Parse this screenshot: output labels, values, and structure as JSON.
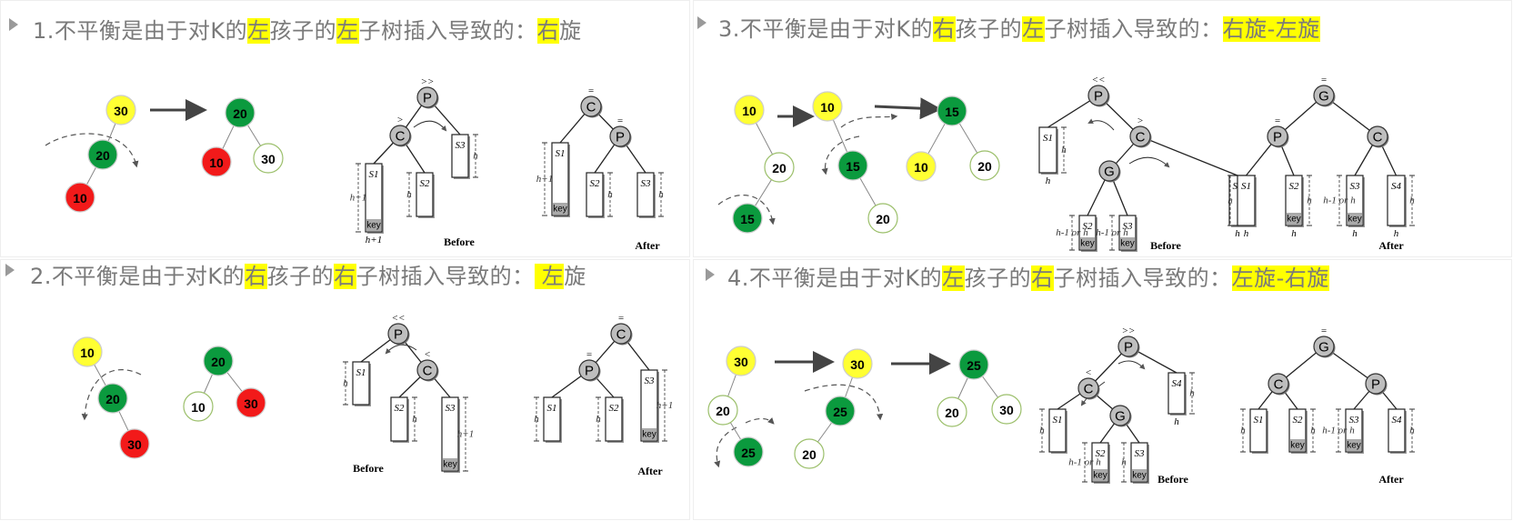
{
  "colors": {
    "yellow": "#ffff33",
    "green": "#0b9a3e",
    "red": "#f21a1a",
    "white": "#ffffff",
    "node_gray": "#bebebe",
    "highlight": "#ffff00",
    "title_text": "#7a7a7a"
  },
  "panels": [
    {
      "title": [
        {
          "t": "1.不平衡是由于对K的"
        },
        {
          "t": "左",
          "hl": true
        },
        {
          "t": "孩子的"
        },
        {
          "t": "左",
          "hl": true
        },
        {
          "t": "子树插入导致的："
        },
        {
          "t": "右",
          "hl": true
        },
        {
          "t": "旋"
        }
      ],
      "number_nodes": [
        {
          "label": "30",
          "color": "yellow"
        },
        {
          "label": "20",
          "color": "green"
        },
        {
          "label": "10",
          "color": "red"
        },
        {
          "label": "20",
          "color": "green"
        },
        {
          "label": "10",
          "color": "red"
        },
        {
          "label": "30",
          "color": "white"
        }
      ],
      "before": {
        "caption": "Before",
        "nodes": [
          {
            "label": "P",
            "mark": ">>"
          },
          {
            "label": "C",
            "mark": ">"
          }
        ],
        "subtrees": [
          {
            "label": "S1",
            "key": "key",
            "height": "h+1",
            "below": "h+1"
          },
          {
            "label": "S2",
            "height": "h"
          },
          {
            "label": "S3",
            "height": "h"
          }
        ]
      },
      "after": {
        "caption": "After",
        "nodes": [
          {
            "label": "C",
            "mark": "="
          },
          {
            "label": "P",
            "mark": "="
          }
        ],
        "subtrees": [
          {
            "label": "S1",
            "key": "key",
            "height": "h+1"
          },
          {
            "label": "S2",
            "height": "h"
          },
          {
            "label": "S3",
            "height": "h"
          }
        ]
      }
    },
    {
      "title": [
        {
          "t": "2.不平衡是由于对K的"
        },
        {
          "t": "右",
          "hl": true
        },
        {
          "t": "孩子的"
        },
        {
          "t": "右",
          "hl": true
        },
        {
          "t": "子树插入导致的："
        },
        {
          "t": " 左",
          "hl": true
        },
        {
          "t": "旋"
        }
      ],
      "number_nodes": [
        {
          "label": "10",
          "color": "yellow"
        },
        {
          "label": "20",
          "color": "green"
        },
        {
          "label": "30",
          "color": "red"
        },
        {
          "label": "20",
          "color": "green"
        },
        {
          "label": "10",
          "color": "white"
        },
        {
          "label": "30",
          "color": "red"
        }
      ],
      "before": {
        "caption": "Before",
        "nodes": [
          {
            "label": "P",
            "mark": "<<"
          },
          {
            "label": "C",
            "mark": "<"
          }
        ],
        "subtrees": [
          {
            "label": "S1",
            "height": "h"
          },
          {
            "label": "S2",
            "height": "h"
          },
          {
            "label": "S3",
            "key": "key",
            "height": "h+1"
          }
        ]
      },
      "after": {
        "caption": "After",
        "nodes": [
          {
            "label": "C",
            "mark": "="
          },
          {
            "label": "P",
            "mark": "="
          }
        ],
        "subtrees": [
          {
            "label": "S1",
            "height": "h"
          },
          {
            "label": "S2",
            "height": "h"
          },
          {
            "label": "S3",
            "key": "key",
            "height": "h+1"
          }
        ]
      }
    },
    {
      "title": [
        {
          "t": "3.不平衡是由于对K的"
        },
        {
          "t": "右",
          "hl": true
        },
        {
          "t": "孩子的"
        },
        {
          "t": "左",
          "hl": true
        },
        {
          "t": "子树插入导致的："
        },
        {
          "t": "右旋-左旋",
          "hl": true
        }
      ],
      "number_nodes": [
        {
          "label": "10",
          "color": "yellow"
        },
        {
          "label": "20",
          "color": "white"
        },
        {
          "label": "15",
          "color": "green"
        },
        {
          "label": "10",
          "color": "yellow"
        },
        {
          "label": "15",
          "color": "green"
        },
        {
          "label": "20",
          "color": "white"
        },
        {
          "label": "15",
          "color": "green"
        },
        {
          "label": "10",
          "color": "yellow"
        },
        {
          "label": "20",
          "color": "white"
        }
      ],
      "before": {
        "caption": "Before",
        "nodes": [
          {
            "label": "P",
            "mark": "<<"
          },
          {
            "label": "C",
            "mark": ">"
          },
          {
            "label": "G",
            "mark": ""
          }
        ],
        "subtrees": [
          {
            "label": "S1",
            "height": "h",
            "below": "h"
          },
          {
            "label": "S1",
            "height": "h",
            "below": "h"
          },
          {
            "label": "S2",
            "key": "key",
            "height": "h-1 or h"
          },
          {
            "label": "S3",
            "key": "key",
            "height": "h-1 or h"
          }
        ]
      },
      "after": {
        "caption": "After",
        "nodes": [
          {
            "label": "G",
            "mark": "="
          },
          {
            "label": "P",
            "mark": "="
          },
          {
            "label": "C",
            "mark": ""
          }
        ],
        "subtrees": [
          {
            "label": "S1",
            "height": "h",
            "below": "h"
          },
          {
            "label": "S2",
            "key": "key",
            "height": "h",
            "below": "h"
          },
          {
            "label": "S3",
            "key": "key",
            "height": "h-1 or h",
            "below": "h"
          },
          {
            "label": "S4",
            "height": "h",
            "below": "h"
          }
        ]
      }
    },
    {
      "title": [
        {
          "t": "4.不平衡是由于对K的"
        },
        {
          "t": "左",
          "hl": true
        },
        {
          "t": "孩子的"
        },
        {
          "t": "右",
          "hl": true
        },
        {
          "t": "子树插入导致的："
        },
        {
          "t": "左旋-右旋",
          "hl": true
        }
      ],
      "number_nodes": [
        {
          "label": "30",
          "color": "yellow"
        },
        {
          "label": "20",
          "color": "white"
        },
        {
          "label": "25",
          "color": "green"
        },
        {
          "label": "30",
          "color": "yellow"
        },
        {
          "label": "25",
          "color": "green"
        },
        {
          "label": "20",
          "color": "white"
        },
        {
          "label": "25",
          "color": "green"
        },
        {
          "label": "20",
          "color": "white"
        },
        {
          "label": "30",
          "color": "white"
        }
      ],
      "before": {
        "caption": "Before",
        "nodes": [
          {
            "label": "P",
            "mark": ">>"
          },
          {
            "label": "C",
            "mark": "<"
          },
          {
            "label": "G",
            "mark": ""
          }
        ],
        "subtrees": [
          {
            "label": "S4",
            "height": "h",
            "below": "h"
          },
          {
            "label": "S1",
            "height": "h"
          },
          {
            "label": "S2",
            "key": "key",
            "height": "h-1 or h"
          },
          {
            "label": "S3",
            "key": "key",
            "height": "h"
          }
        ]
      },
      "after": {
        "caption": "After",
        "nodes": [
          {
            "label": "G",
            "mark": "="
          },
          {
            "label": "C",
            "mark": ""
          },
          {
            "label": "P",
            "mark": ""
          }
        ],
        "subtrees": [
          {
            "label": "S1",
            "height": "h"
          },
          {
            "label": "S2",
            "key": "key",
            "height": "h"
          },
          {
            "label": "S3",
            "key": "key",
            "height": "h-1 or h"
          },
          {
            "label": "S4",
            "height": "h"
          }
        ]
      }
    }
  ]
}
